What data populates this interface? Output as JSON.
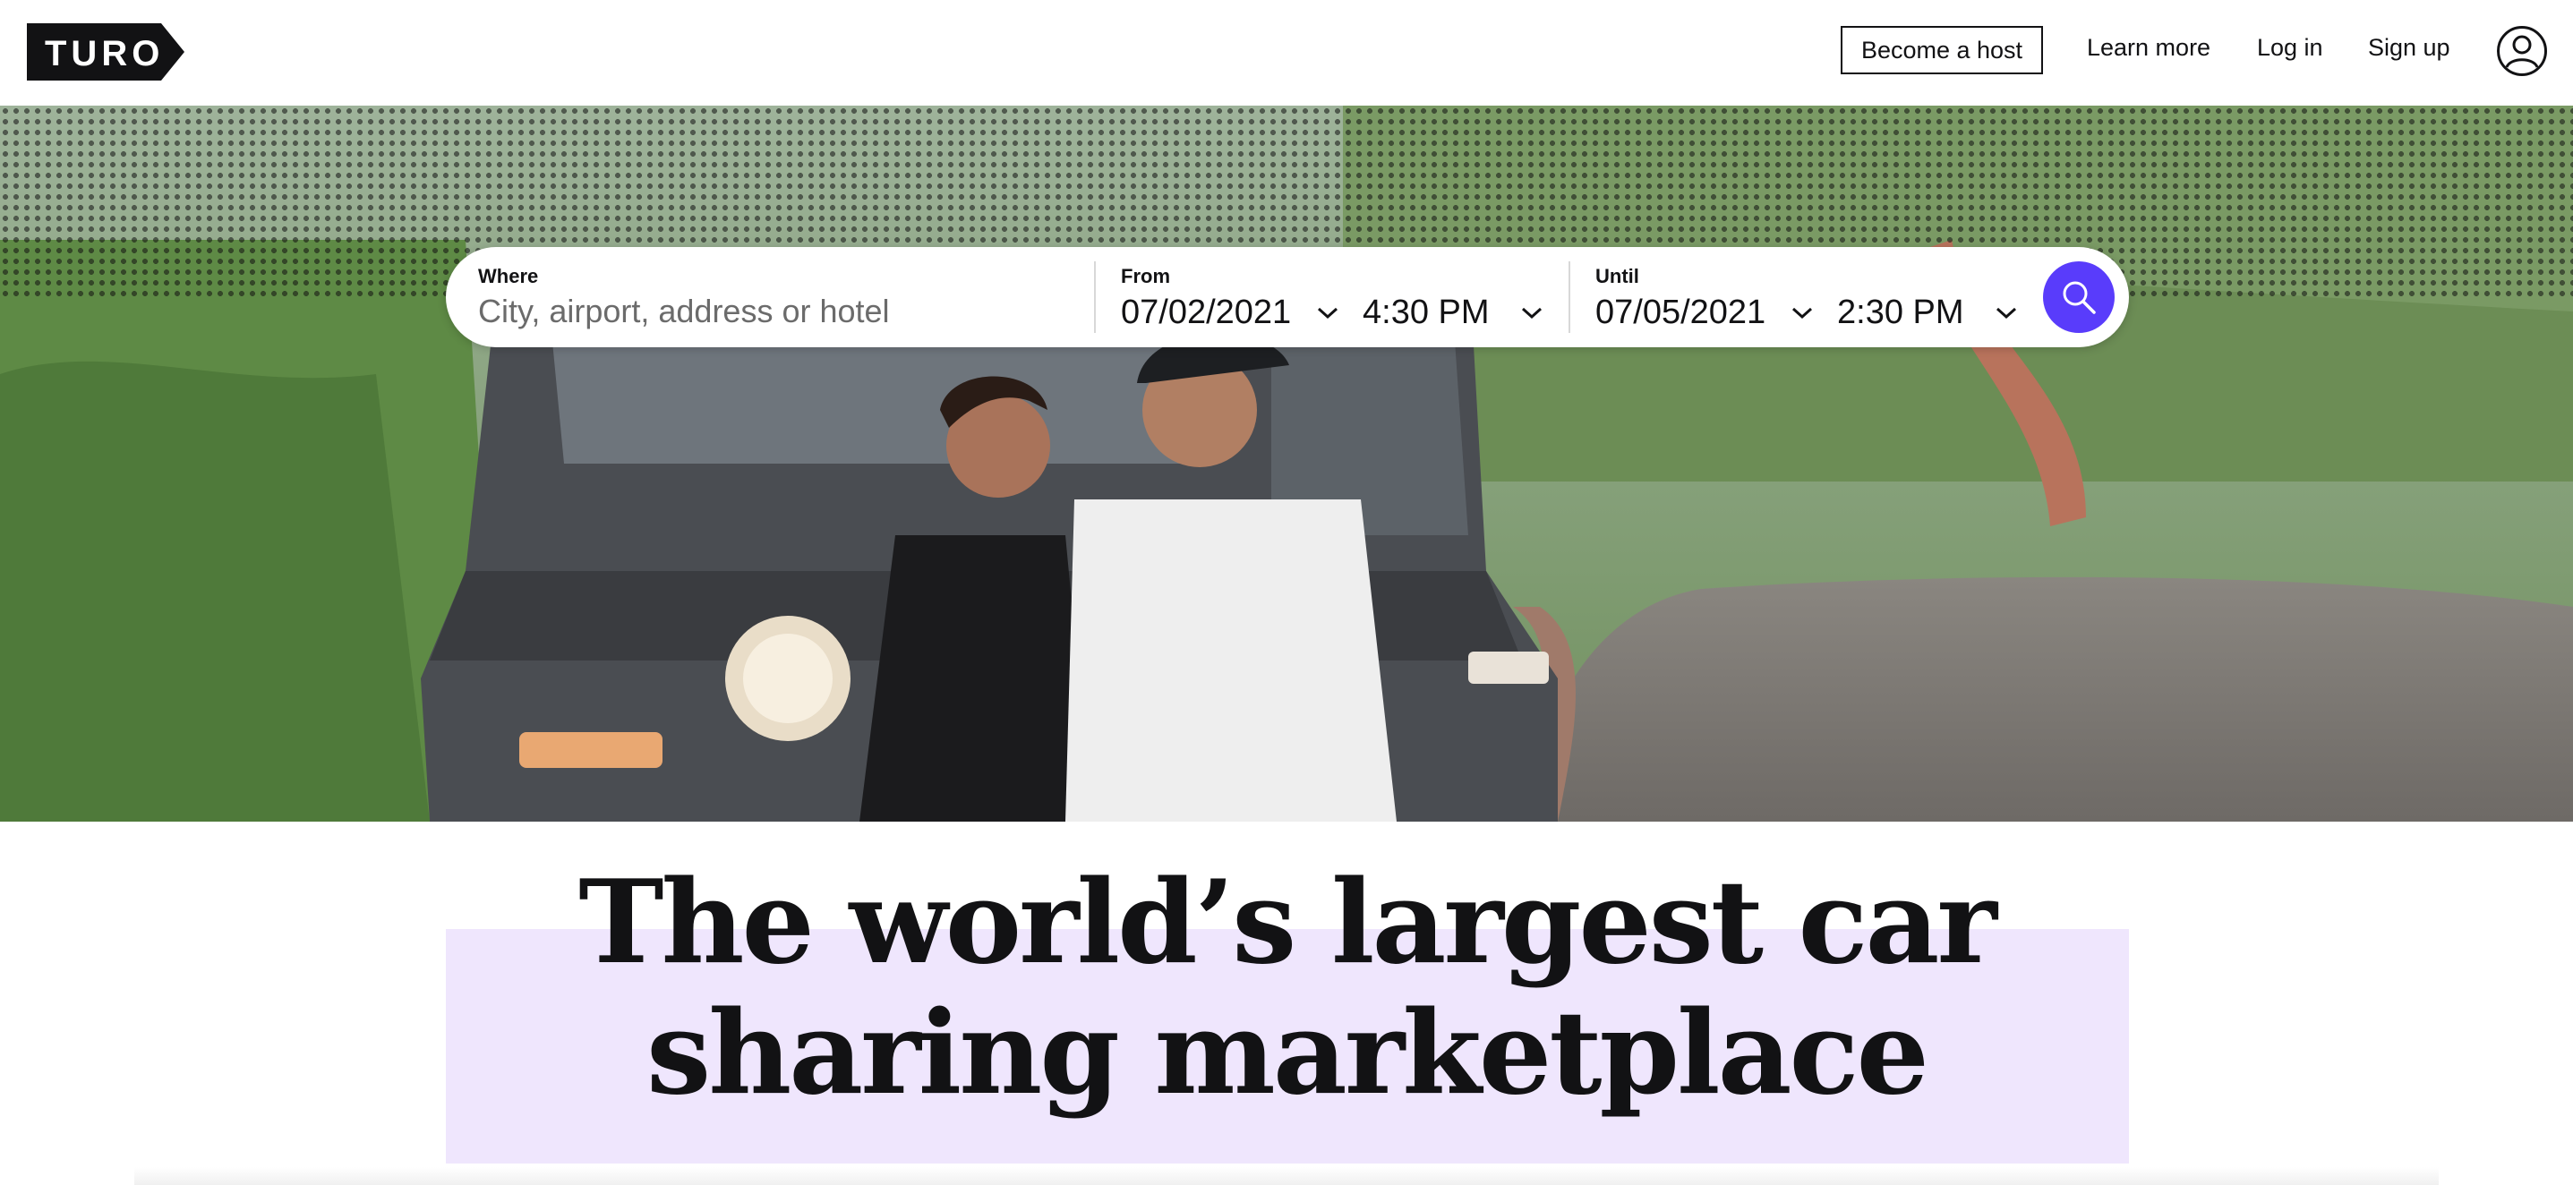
{
  "header": {
    "logo_text": "TURO",
    "become_host_label": "Become a host",
    "learn_more_label": "Learn more",
    "log_in_label": "Log in",
    "sign_up_label": "Sign up",
    "profile_icon": "user-circle-icon"
  },
  "search": {
    "where_label": "Where",
    "where_placeholder": "City, airport, address or hotel",
    "from_label": "From",
    "from_date": "07/02/2021",
    "from_time": "4:30 PM",
    "until_label": "Until",
    "until_date": "07/05/2021",
    "until_time": "2:30 PM",
    "search_icon": "search-icon"
  },
  "hero": {
    "headline_line1": "The world’s largest car",
    "headline_line2": "sharing marketplace"
  },
  "colors": {
    "accent": "#593cfb",
    "highlight": "#efe6fd",
    "text": "#121214"
  }
}
